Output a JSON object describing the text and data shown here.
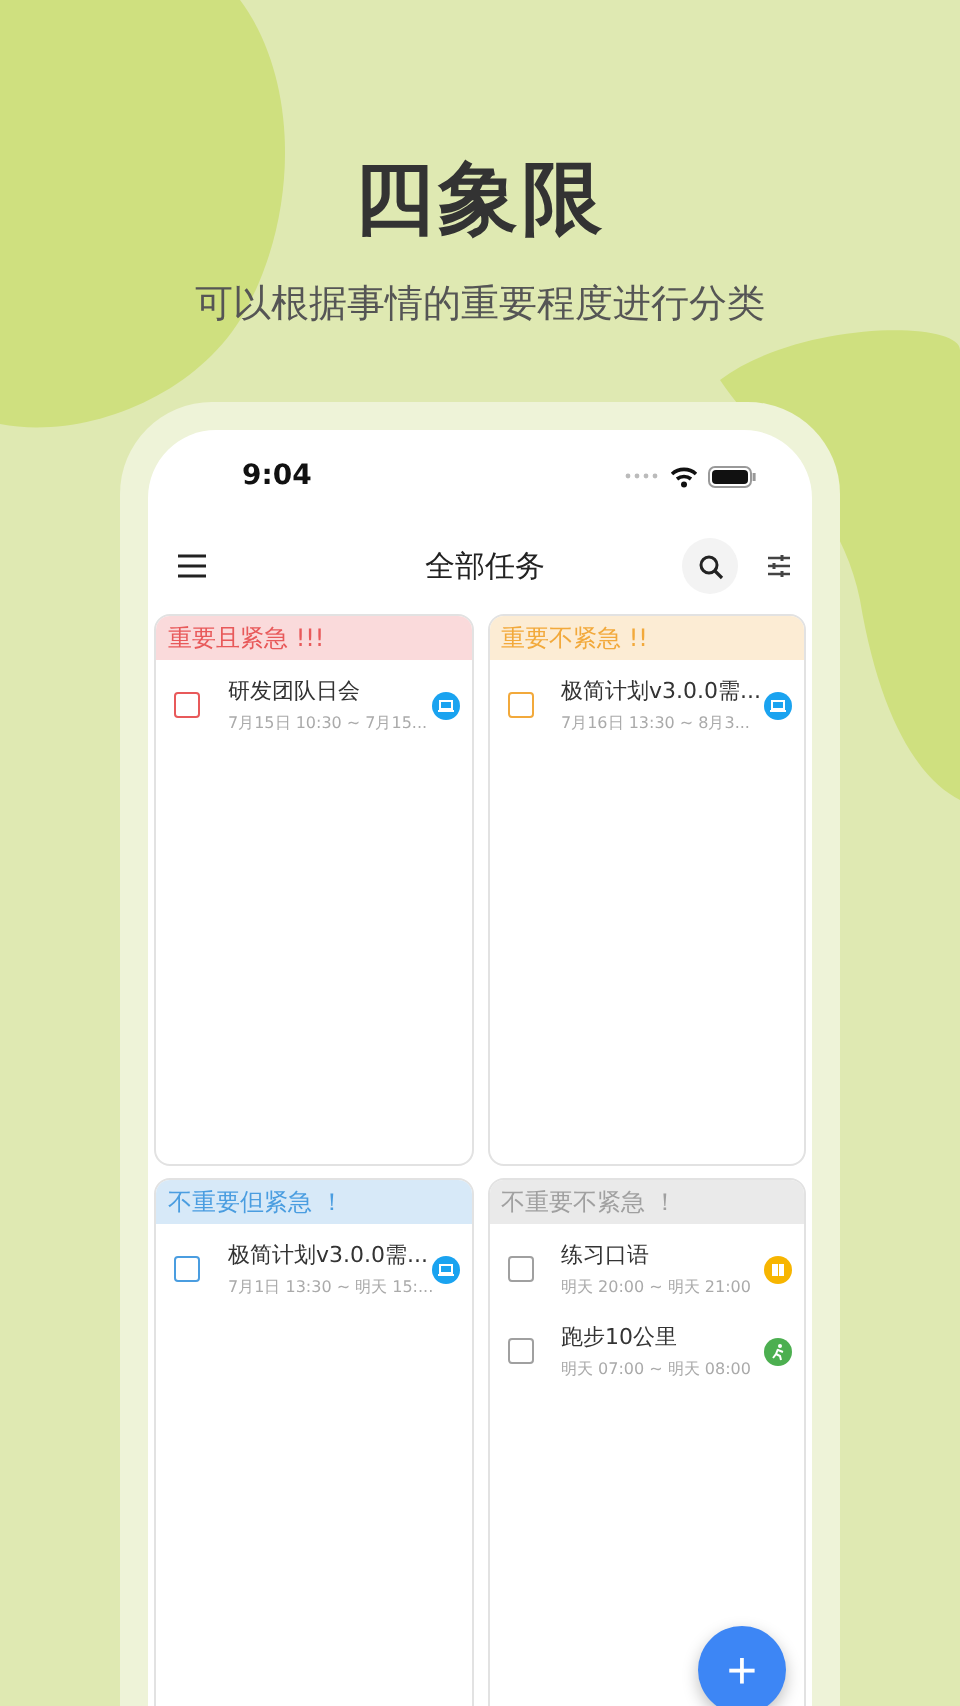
{
  "headline": "四象限",
  "subtitle": "可以根据事情的重要程度进行分类",
  "status_bar": {
    "time": "9:04"
  },
  "nav": {
    "title": "全部任务"
  },
  "quadrants": [
    {
      "title": "重要且紧急 !!!",
      "color": "#e8595a",
      "tasks": [
        {
          "title": "研发团队日会",
          "time": "7月15日 10:30 ~ 7月15...",
          "kind": "laptop",
          "color": "#1aa3f0",
          "checked": false
        }
      ]
    },
    {
      "title": "重要不紧急 !!",
      "color": "#f2a93b",
      "tasks": [
        {
          "title": "极简计划v3.0.0需...",
          "time": "7月16日 13:30 ~ 8月3...",
          "kind": "laptop",
          "color": "#1aa3f0",
          "checked": false
        }
      ]
    },
    {
      "title": "不重要但紧急 ！",
      "color": "#4a9de0",
      "tasks": [
        {
          "title": "极简计划v3.0.0需...",
          "time": "7月1日 13:30 ~ 明天 15:...",
          "kind": "laptop",
          "color": "#1aa3f0",
          "checked": false
        }
      ]
    },
    {
      "title": "不重要不紧急 ！",
      "color": "#a0a0a0",
      "tasks": [
        {
          "title": "练习口语",
          "time": "明天 20:00 ~ 明天 21:00",
          "kind": "book",
          "color": "#f7b500",
          "checked": false
        },
        {
          "title": "跑步10公里",
          "time": "明天 07:00 ~ 明天 08:00",
          "kind": "runner",
          "color": "#4caf50",
          "checked": false
        }
      ]
    }
  ],
  "fab": {
    "label": "+"
  }
}
